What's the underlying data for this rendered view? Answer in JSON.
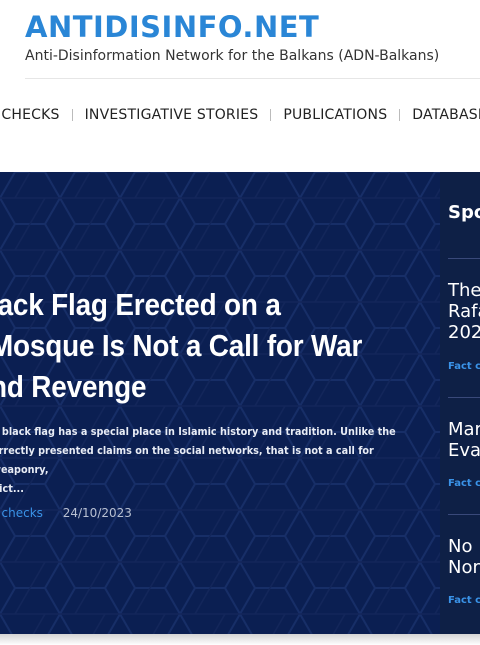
{
  "header": {
    "site_title": "ANTIDISINFO.NET",
    "site_subtitle": "Anti-Disinformation Network for the Balkans (ADN-Balkans)"
  },
  "nav": {
    "items": [
      {
        "label": "T CHECKS"
      },
      {
        "label": "INVESTIGATIVE STORIES"
      },
      {
        "label": "PUBLICATIONS"
      },
      {
        "label": "DATABASE"
      }
    ]
  },
  "hero": {
    "title_lines": [
      "lack Flag Erected on a",
      "Mosque Is Not a Call for War",
      "nd Revenge"
    ],
    "excerpt_lines": [
      "e black flag has a special place in Islamic history and tradition. Unlike the",
      "orrectly presented claims on the social networks, that is not a call for weaponry,",
      "flict..."
    ],
    "category": "t checks",
    "date": "24/10/2023"
  },
  "sidebar": {
    "heading": "Spo",
    "items": [
      {
        "title_lines": [
          "The",
          "Rafa",
          "202"
        ],
        "category": "Fact ch"
      },
      {
        "title_lines": [
          "Mar",
          "Eva"
        ],
        "category": "Fact ch"
      },
      {
        "title_lines": [
          "No",
          "Nor"
        ],
        "category": "Fact ch"
      }
    ]
  },
  "colors": {
    "brand_blue": "#2a86d6",
    "hero_background": "#0b1f52",
    "link_blue": "#3a93e8"
  }
}
